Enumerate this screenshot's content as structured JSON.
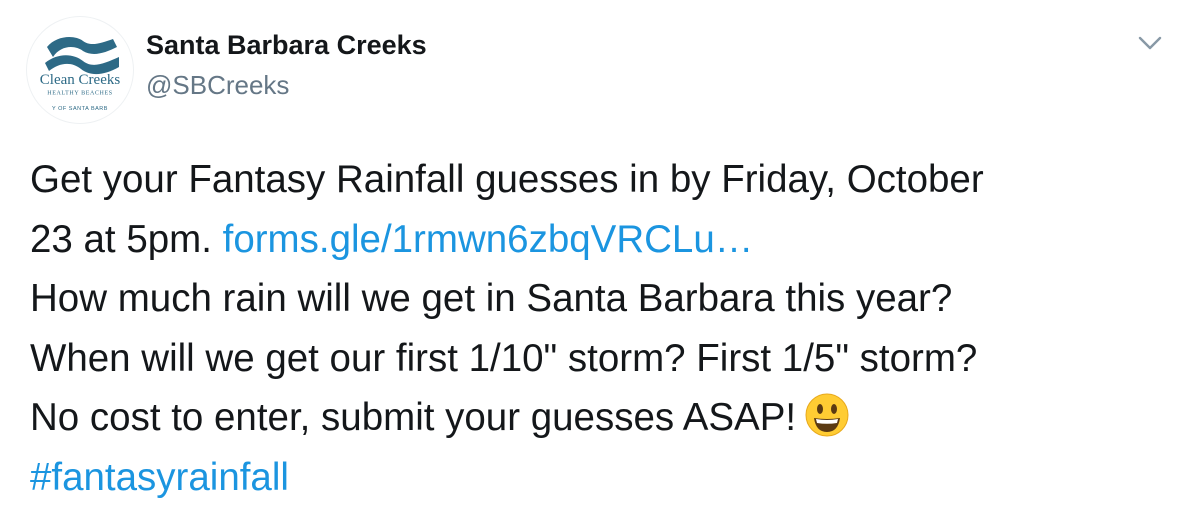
{
  "header": {
    "display_name": "Santa Barbara Creeks",
    "handle": "@SBCreeks",
    "more_icon": "chevron-down-icon"
  },
  "avatar": {
    "logo_text_main": "Clean Creeks",
    "logo_text_sub": "HEALTHY BEACHES",
    "logo_text_arc": "Y OF SANTA BARB",
    "brand_color": "#2d6a86"
  },
  "tweet": {
    "line1": "Get your Fantasy Rainfall guesses in by Friday, October",
    "line2_text": "23 at 5pm.",
    "link": "forms.gle/1rmwn6zbqVRCLu…",
    "line3": "How much rain will we get in Santa Barbara this year?",
    "line4": "When will we get our first 1/10\" storm? First 1/5\" storm?",
    "line5": "No cost to enter, submit your guesses ASAP!",
    "emoji": "grinning-face-emoji",
    "hashtag": "#fantasyrainfall"
  },
  "colors": {
    "text": "#14171a",
    "secondary": "#657786",
    "link": "#1b95e0"
  }
}
